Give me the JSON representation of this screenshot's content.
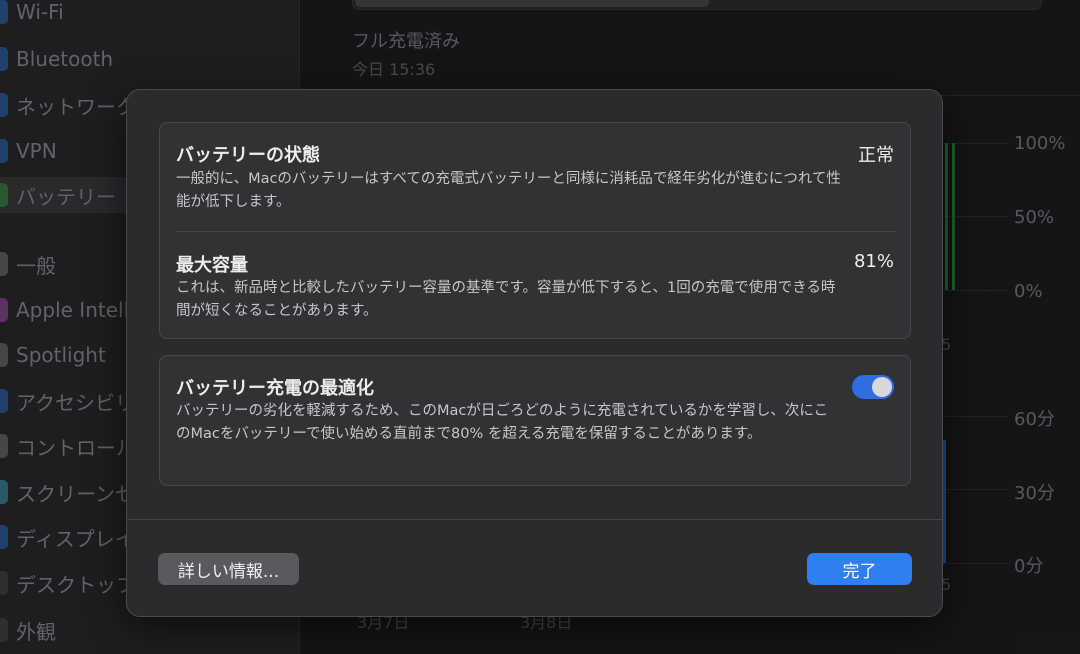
{
  "sidebar": {
    "items": [
      {
        "label": "Wi-Fi",
        "color": "#2f7ff0"
      },
      {
        "label": "Bluetooth",
        "color": "#2f7ff0"
      },
      {
        "label": "ネットワーク",
        "color": "#2f7ff0"
      },
      {
        "label": "VPN",
        "color": "#2f7ff0"
      },
      {
        "label": "バッテリー",
        "color": "#3cae4a"
      },
      {
        "label": "一般",
        "color": "#8e8e93"
      },
      {
        "label": "Apple Intelli",
        "color": "#c65bd6"
      },
      {
        "label": "Spotlight",
        "color": "#8e8e93"
      },
      {
        "label": "アクセシビリ",
        "color": "#2f7ff0"
      },
      {
        "label": "コントロール",
        "color": "#8e8e93"
      },
      {
        "label": "スクリーンセ",
        "color": "#3ec2dc"
      },
      {
        "label": "ディスプレイ",
        "color": "#2f7ff0"
      },
      {
        "label": "デスクトップ",
        "color": "#2a2a2d"
      },
      {
        "label": "外観",
        "color": "#1a1a1a"
      }
    ]
  },
  "background": {
    "charge_status": "フル充電済み",
    "charge_time": "今日 15:36",
    "pct_100": "100%",
    "pct_50": "50%",
    "pct_0": "0%",
    "min_60": "60分",
    "min_30": "30分",
    "min_0": "0分",
    "frag_5a": "5",
    "frag_5b": "5",
    "date_a": "3月7日",
    "date_b": "3月8日"
  },
  "dialog": {
    "health": {
      "title": "バッテリーの状態",
      "value": "正常",
      "desc": "一般的に、Macのバッテリーはすべての充電式バッテリーと同様に消耗品で経年劣化が進むにつれて性能が低下します。"
    },
    "capacity": {
      "title": "最大容量",
      "value": "81%",
      "desc": "これは、新品時と比較したバッテリー容量の基準です。容量が低下すると、1回の充電で使用できる時間が短くなることがあります。"
    },
    "optimize": {
      "title": "バッテリー充電の最適化",
      "enabled": true,
      "desc": "バッテリーの劣化を軽減するため、このMacが日ごろどのように充電されているかを学習し、次にこのMacをバッテリーで使い始める直前まで80% を超える充電を保留することがあります。"
    },
    "more_info_label": "詳しい情報...",
    "done_label": "完了"
  },
  "colors": {
    "accent": "#2f7ff0",
    "battery_green": "#2f8a3c"
  }
}
